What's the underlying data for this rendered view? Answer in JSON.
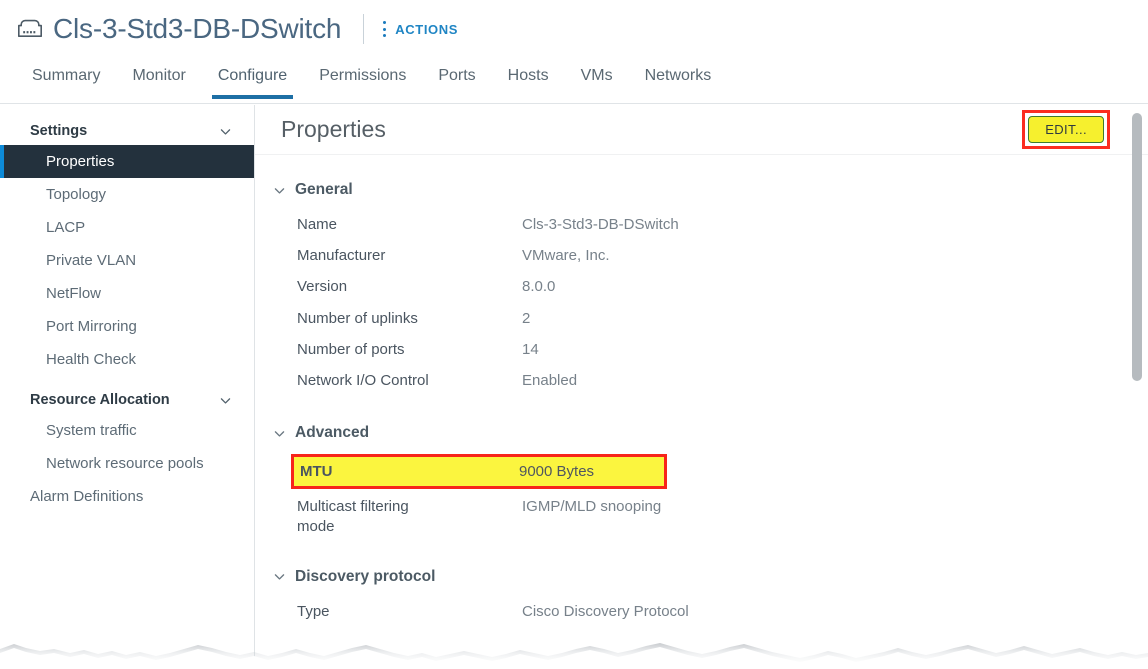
{
  "header": {
    "icon": "distributed-switch-icon",
    "title": "Cls-3-Std3-DB-DSwitch",
    "actions_label": "ACTIONS",
    "kebab_icon": "vertical-ellipsis-icon"
  },
  "tabs": [
    {
      "label": "Summary",
      "active": false
    },
    {
      "label": "Monitor",
      "active": false
    },
    {
      "label": "Configure",
      "active": true
    },
    {
      "label": "Permissions",
      "active": false
    },
    {
      "label": "Ports",
      "active": false
    },
    {
      "label": "Hosts",
      "active": false
    },
    {
      "label": "VMs",
      "active": false
    },
    {
      "label": "Networks",
      "active": false
    }
  ],
  "sidebar": {
    "groups": [
      {
        "header": "Settings",
        "chevron": "chevron-down-icon",
        "items": [
          {
            "label": "Properties",
            "selected": true
          },
          {
            "label": "Topology",
            "selected": false
          },
          {
            "label": "LACP",
            "selected": false
          },
          {
            "label": "Private VLAN",
            "selected": false
          },
          {
            "label": "NetFlow",
            "selected": false
          },
          {
            "label": "Port Mirroring",
            "selected": false
          },
          {
            "label": "Health Check",
            "selected": false
          }
        ]
      },
      {
        "header": "Resource Allocation",
        "chevron": "chevron-down-icon",
        "items": [
          {
            "label": "System traffic",
            "selected": false
          },
          {
            "label": "Network resource pools",
            "selected": false
          }
        ]
      }
    ],
    "standalone_item": "Alarm Definitions"
  },
  "content": {
    "page_title": "Properties",
    "edit_button": "EDIT...",
    "sections": [
      {
        "name": "General",
        "chevron": "chevron-down-icon",
        "rows": [
          {
            "label": "Name",
            "value": "Cls-3-Std3-DB-DSwitch"
          },
          {
            "label": "Manufacturer",
            "value": "VMware, Inc."
          },
          {
            "label": "Version",
            "value": "8.0.0"
          },
          {
            "label": "Number of uplinks",
            "value": "2"
          },
          {
            "label": "Number of ports",
            "value": "14"
          },
          {
            "label": "Network I/O Control",
            "value": "Enabled"
          }
        ]
      },
      {
        "name": "Advanced",
        "chevron": "chevron-down-icon",
        "rows": [
          {
            "label": "MTU",
            "value": "9000 Bytes",
            "highlighted": true
          },
          {
            "label": "Multicast filtering mode",
            "value": "IGMP/MLD snooping"
          }
        ]
      },
      {
        "name": "Discovery protocol",
        "chevron": "chevron-down-icon",
        "rows": [
          {
            "label": "Type",
            "value": "Cisco Discovery Protocol"
          }
        ]
      }
    ]
  },
  "colors": {
    "accent_blue": "#1d6fa5",
    "link_blue": "#1f85c4",
    "selected_nav_bg": "#23313d",
    "selected_nav_bar": "#0d8bd9",
    "highlight_yellow": "#fbf53f",
    "highlight_red_border": "#f7251a",
    "edit_button_yellow": "#f6f02e",
    "edit_button_green_border": "#3f7a2e",
    "title_slate": "#4a6781"
  },
  "scrollbar": {
    "name": "vertical-scrollbar",
    "orientation": "vertical"
  }
}
